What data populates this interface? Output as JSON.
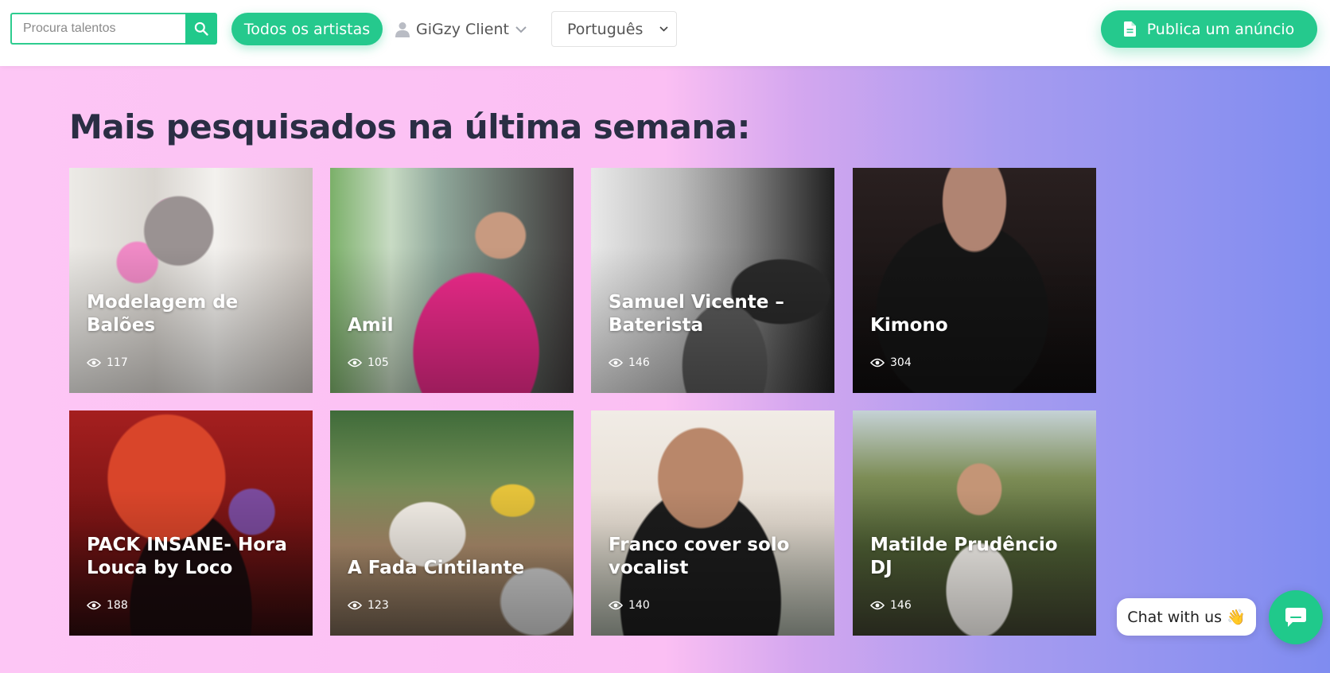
{
  "header": {
    "search": {
      "placeholder": "Procura talentos",
      "value": ""
    },
    "all_artists_label": "Todos os artistas",
    "user_menu_label": "GiGzy Client",
    "language_selected": "Português",
    "publish_label": "Publica um anúncio"
  },
  "main": {
    "title": "Mais pesquisados na última semana:",
    "cards": [
      {
        "title": "Modelagem de Balões",
        "views": "117"
      },
      {
        "title": "Amil",
        "views": "105"
      },
      {
        "title": "Samuel Vicente – Baterista",
        "views": "146"
      },
      {
        "title": "Kimono",
        "views": "304"
      },
      {
        "title": "PACK INSANE- Hora Louca by Loco",
        "views": "188"
      },
      {
        "title": "A Fada Cintilante",
        "views": "123"
      },
      {
        "title": "Franco cover solo vocalist",
        "views": "140"
      },
      {
        "title": "Matilde Prudêncio DJ",
        "views": "146"
      }
    ]
  },
  "chat": {
    "label": "Chat with us",
    "emoji": "👋"
  },
  "colors": {
    "accent": "#25c98d",
    "title": "#2a2e44"
  },
  "icons": [
    "search-icon",
    "user-icon",
    "chevron-down-icon",
    "document-icon",
    "eye-icon",
    "chat-icon"
  ]
}
